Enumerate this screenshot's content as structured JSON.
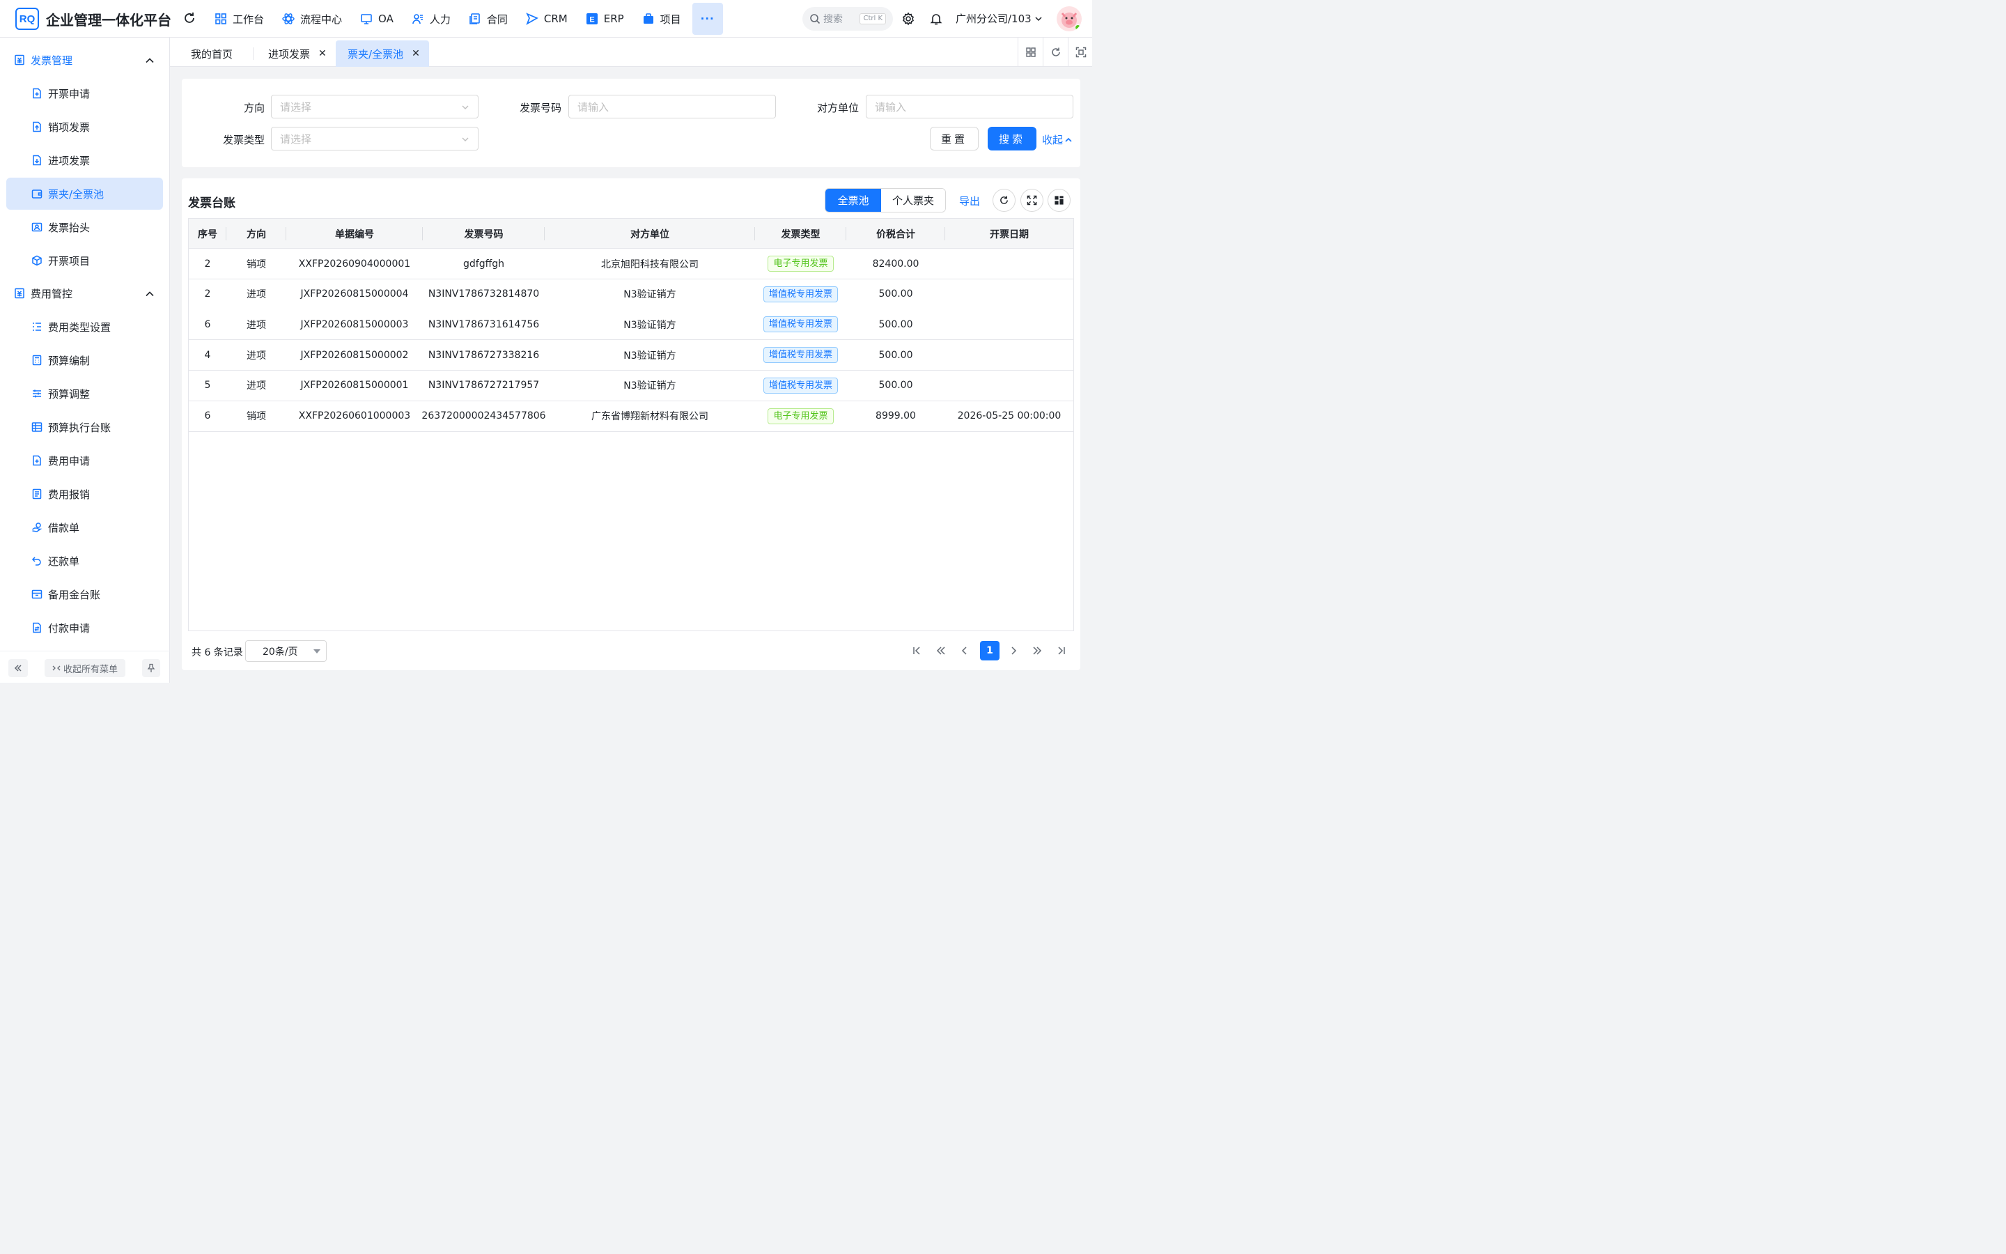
{
  "app": {
    "logo_text": "RQ",
    "title": "企业管理一体化平台"
  },
  "nav": [
    {
      "label": "工作台",
      "icon": "grid-icon"
    },
    {
      "label": "流程中心",
      "icon": "atom-icon"
    },
    {
      "label": "OA",
      "icon": "monitor-icon"
    },
    {
      "label": "人力",
      "icon": "users-icon"
    },
    {
      "label": "合同",
      "icon": "document-icon"
    },
    {
      "label": "CRM",
      "icon": "send-icon"
    },
    {
      "label": "ERP",
      "icon": "erp-icon"
    },
    {
      "label": "项目",
      "icon": "briefcase-icon"
    }
  ],
  "nav_more": "···",
  "search": {
    "placeholder": "搜索",
    "shortcut": "Ctrl K"
  },
  "company": "广州分公司/103",
  "sidebar": {
    "group1": "发票管理",
    "items1": [
      "开票申请",
      "销项发票",
      "进项发票",
      "票夹/全票池",
      "发票抬头",
      "开票项目"
    ],
    "group2": "费用管控",
    "items2": [
      "费用类型设置",
      "预算编制",
      "预算调整",
      "预算执行台账",
      "费用申请",
      "费用报销",
      "借款单",
      "还款单",
      "备用金台账",
      "付款申请"
    ],
    "collapse_all": "收起所有菜单"
  },
  "tabs": [
    {
      "label": "我的首页"
    },
    {
      "label": "进项发票"
    },
    {
      "label": "票夹/全票池"
    }
  ],
  "form": {
    "direction_label": "方向",
    "direction_placeholder": "请选择",
    "invoice_no_label": "发票号码",
    "invoice_no_placeholder": "请输入",
    "counterparty_label": "对方单位",
    "counterparty_placeholder": "请输入",
    "invoice_type_label": "发票类型",
    "invoice_type_placeholder": "请选择",
    "reset": "重置",
    "search": "搜索",
    "collapse": "收起"
  },
  "ledger": {
    "title": "发票台账",
    "seg_all": "全票池",
    "seg_personal": "个人票夹",
    "export": "导出"
  },
  "table": {
    "headers": [
      "序号",
      "方向",
      "单据编号",
      "发票号码",
      "对方单位",
      "发票类型",
      "价税合计",
      "开票日期"
    ],
    "rows": [
      {
        "no": "2",
        "dir": "销项",
        "doc": "XXFP20260904000001",
        "inv": "gdfgffgh",
        "party": "北京旭阳科技有限公司",
        "type": "电子专用发票",
        "type_style": "green",
        "amount": "82400.00",
        "date": ""
      },
      {
        "no": "2",
        "dir": "进项",
        "doc": "JXFP20260815000004",
        "inv": "N3INV1786732814870",
        "party": "N3验证销方",
        "type": "增值税专用发票",
        "type_style": "blue",
        "amount": "500.00",
        "date": ""
      },
      {
        "no": "6",
        "dir": "进项",
        "doc": "JXFP20260815000003",
        "inv": "N3INV1786731614756",
        "party": "N3验证销方",
        "type": "增值税专用发票",
        "type_style": "blue",
        "amount": "500.00",
        "date": ""
      },
      {
        "no": "4",
        "dir": "进项",
        "doc": "JXFP20260815000002",
        "inv": "N3INV1786727338216",
        "party": "N3验证销方",
        "type": "增值税专用发票",
        "type_style": "blue",
        "amount": "500.00",
        "date": ""
      },
      {
        "no": "5",
        "dir": "进项",
        "doc": "JXFP20260815000001",
        "inv": "N3INV1786727217957",
        "party": "N3验证销方",
        "type": "增值税专用发票",
        "type_style": "blue",
        "amount": "500.00",
        "date": ""
      },
      {
        "no": "6",
        "dir": "销项",
        "doc": "XXFP20260601000003",
        "inv": "26372000002434577806",
        "party": "广东省博翔新材料有限公司",
        "type": "电子专用发票",
        "type_style": "green",
        "amount": "8999.00",
        "date": "2026-05-25 00:00:00"
      }
    ]
  },
  "pagination": {
    "total": "共 6 条记录",
    "page_size": "20条/页",
    "current": "1"
  },
  "colors": {
    "primary": "#1677ff",
    "active_bg": "#dbe8fd"
  }
}
